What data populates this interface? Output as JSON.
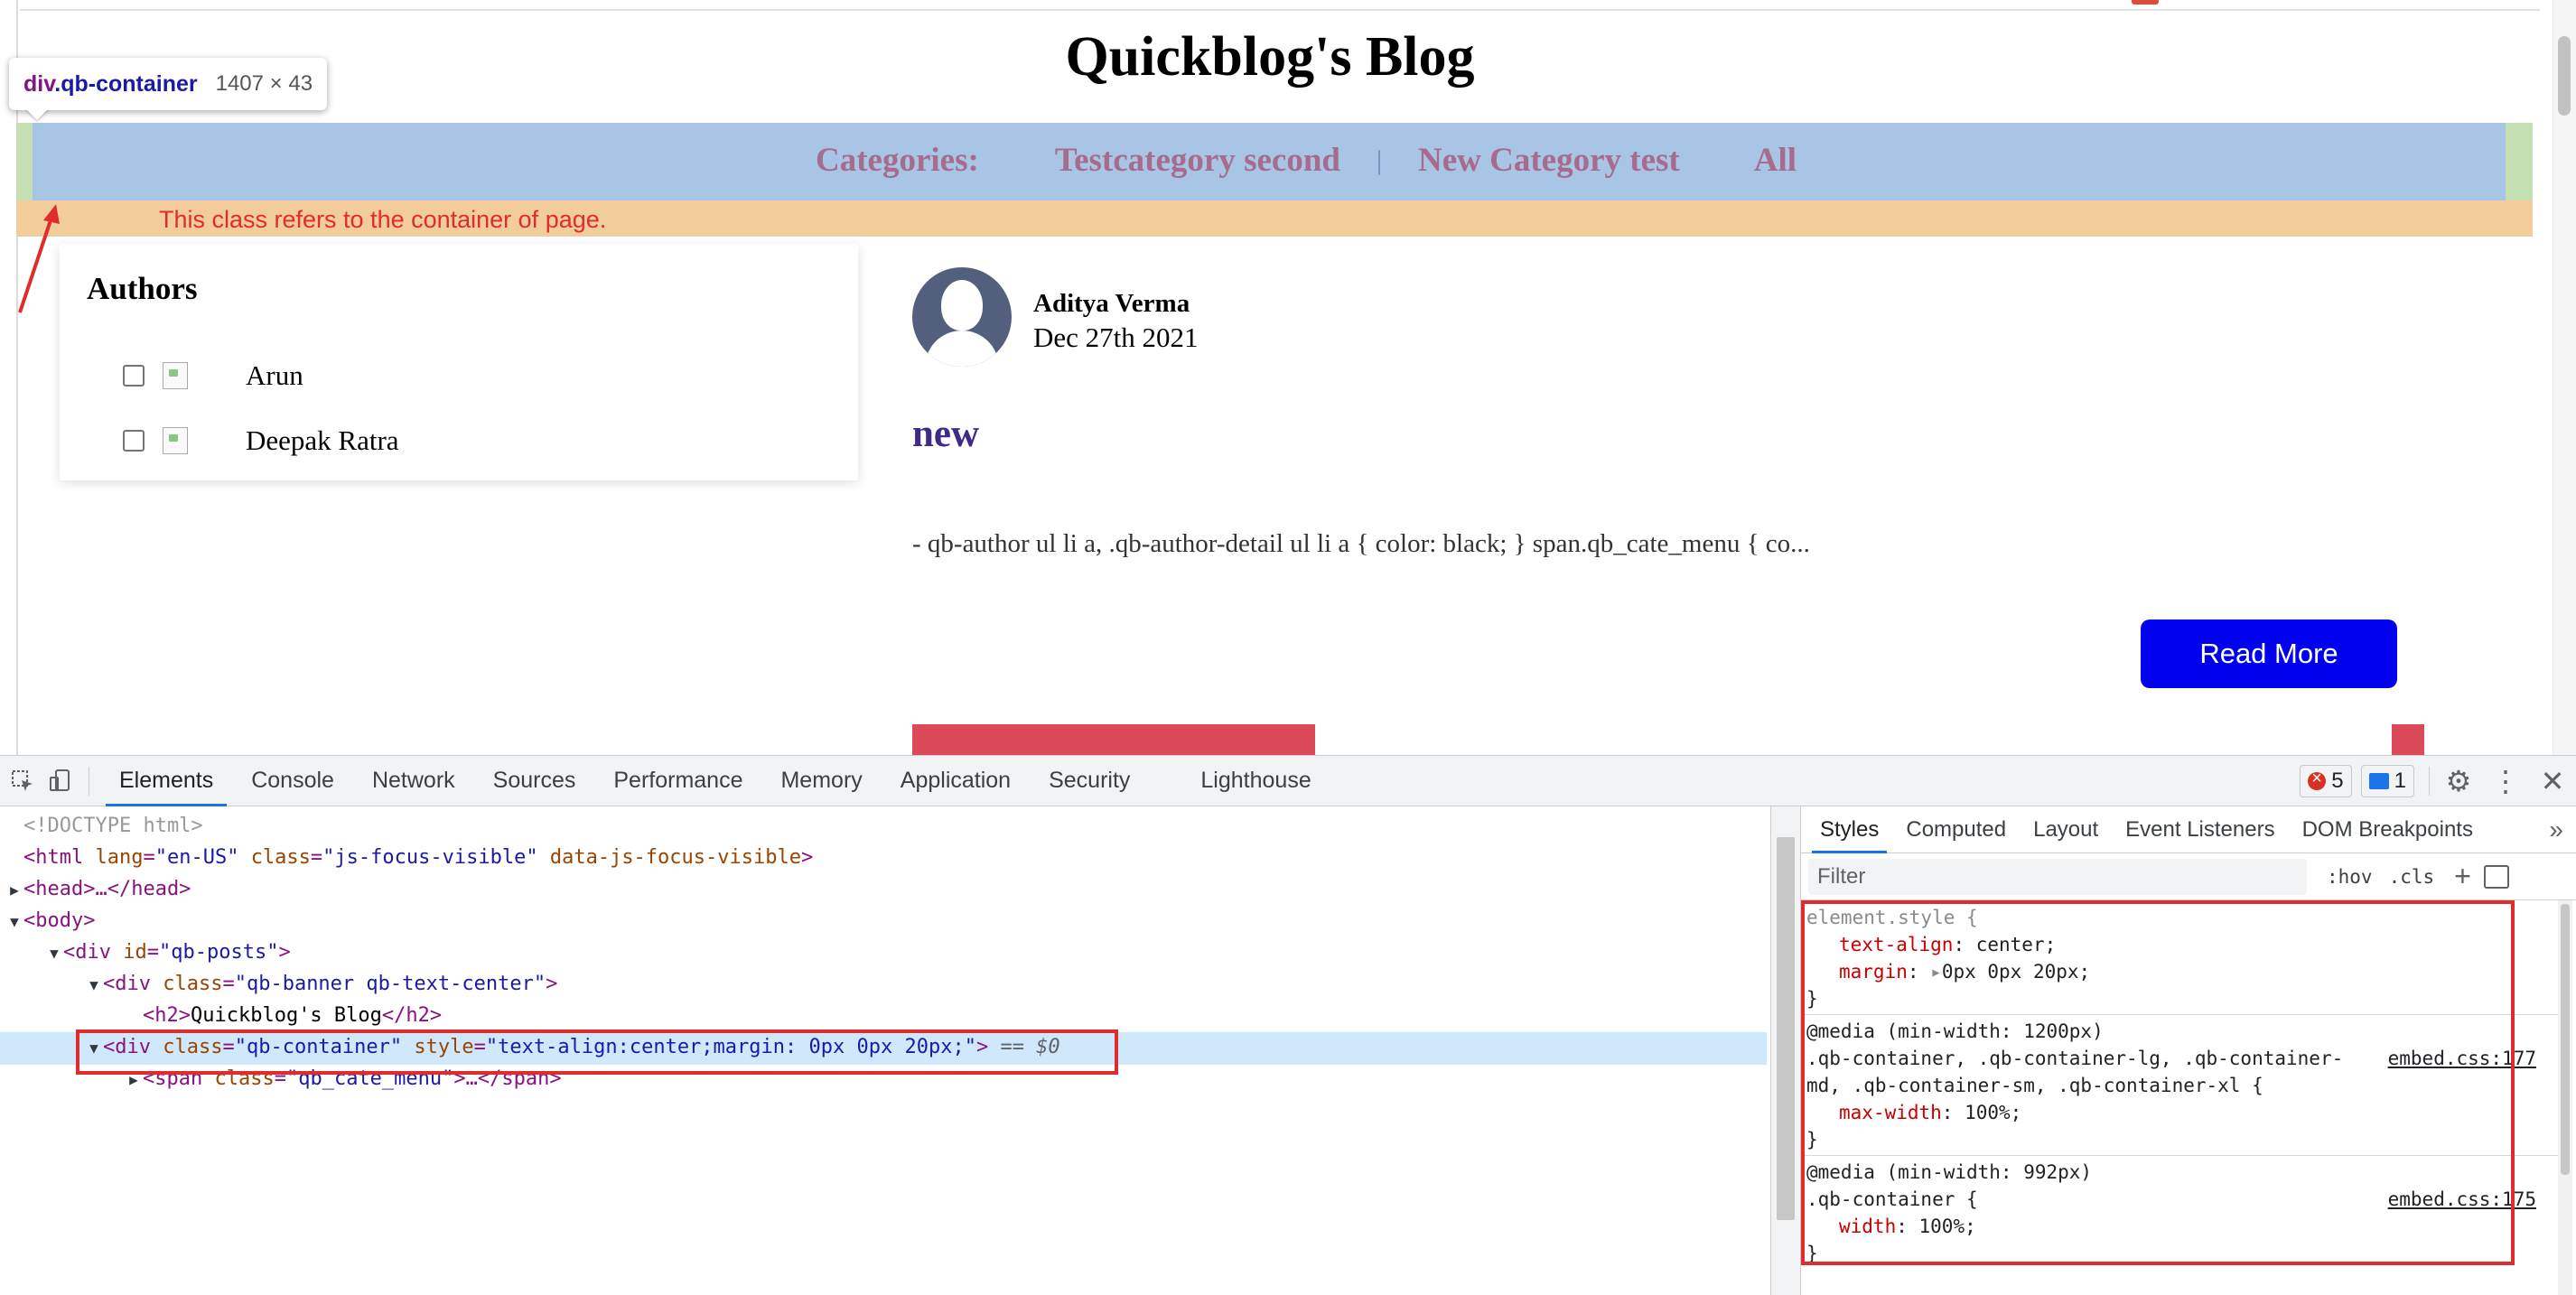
{
  "page": {
    "blog_title": "Quickblog's Blog",
    "hover_tooltip": {
      "selector_tag": "div",
      "selector_class": ".qb-container",
      "dimensions": "1407 × 43"
    },
    "categories": {
      "label": "Categories:",
      "items": [
        "Testcategory second",
        "New Category test",
        "All"
      ],
      "separator": "|"
    },
    "annotation": "This class refers to the container of page.",
    "authors_widget": {
      "heading": "Authors",
      "authors": [
        {
          "name": "Arun"
        },
        {
          "name": "Deepak Ratra"
        }
      ]
    },
    "post": {
      "author": "Aditya Verma",
      "date": "Dec 27th 2021",
      "title": "new",
      "excerpt": "- qb-author ul li a, .qb-author-detail ul li a { color: black; } span.qb_cate_menu { co...",
      "read_more_label": "Read More"
    }
  },
  "devtools": {
    "tabs": [
      "Elements",
      "Console",
      "Network",
      "Sources",
      "Performance",
      "Memory",
      "Application",
      "Security",
      "Lighthouse"
    ],
    "active_tab": "Elements",
    "error_count": "5",
    "message_count": "1",
    "dom_lines": [
      {
        "indent": 0,
        "tri": "",
        "doctype": "<!DOCTYPE html>"
      },
      {
        "indent": 0,
        "tri": "",
        "open": "<html",
        "attrs": [
          [
            "lang",
            "en-US"
          ],
          [
            "class",
            "js-focus-visible"
          ],
          [
            "data-js-focus-visible",
            ""
          ]
        ],
        "close": ">"
      },
      {
        "indent": 0,
        "tri": "▶",
        "text": "<head>…</head>"
      },
      {
        "indent": 0,
        "tri": "▼",
        "text": "<body>"
      },
      {
        "indent": 1,
        "tri": "▼",
        "open": "<div",
        "attrs": [
          [
            "id",
            "qb-posts"
          ]
        ],
        "close": ">"
      },
      {
        "indent": 2,
        "tri": "▼",
        "open": "<div",
        "attrs": [
          [
            "class",
            "qb-banner qb-text-center"
          ]
        ],
        "close": ">"
      },
      {
        "indent": 3,
        "tri": "",
        "h2": [
          "<h2>",
          "Quickblog's Blog",
          "</h2>"
        ]
      },
      {
        "indent": 2,
        "tri": "▼",
        "open": "<div",
        "attrs": [
          [
            "class",
            "qb-container"
          ],
          [
            "style",
            "text-align:center;margin: 0px 0px 20px;"
          ]
        ],
        "close": ">",
        "suffix": " == $0",
        "selected": true
      },
      {
        "indent": 3,
        "tri": "▶",
        "span": [
          "<span ",
          "class",
          "qb_cate_menu",
          ">…</span>"
        ]
      }
    ],
    "styles_tabs": [
      "Styles",
      "Computed",
      "Layout",
      "Event Listeners",
      "DOM Breakpoints"
    ],
    "filter_placeholder": "Filter",
    "hov_label": ":hov",
    "cls_label": ".cls",
    "css": {
      "element_style": {
        "selector": "element.style {",
        "props": [
          [
            "text-align",
            "center"
          ],
          [
            "margin",
            "0px 0px 20px"
          ]
        ]
      },
      "rule1": {
        "media": "@media (min-width: 1200px)",
        "selector_line1": ".qb-container, .qb-container-lg, .qb-container-",
        "selector_line2": "md, .qb-container-sm, .qb-container-xl {",
        "source": "embed.css:177",
        "props": [
          [
            "max-width",
            "100%"
          ]
        ]
      },
      "rule2": {
        "media": "@media (min-width: 992px)",
        "selector": ".qb-container {",
        "source": "embed.css:175",
        "props": [
          [
            "width",
            "100%"
          ]
        ]
      },
      "close_brace": "}"
    }
  }
}
